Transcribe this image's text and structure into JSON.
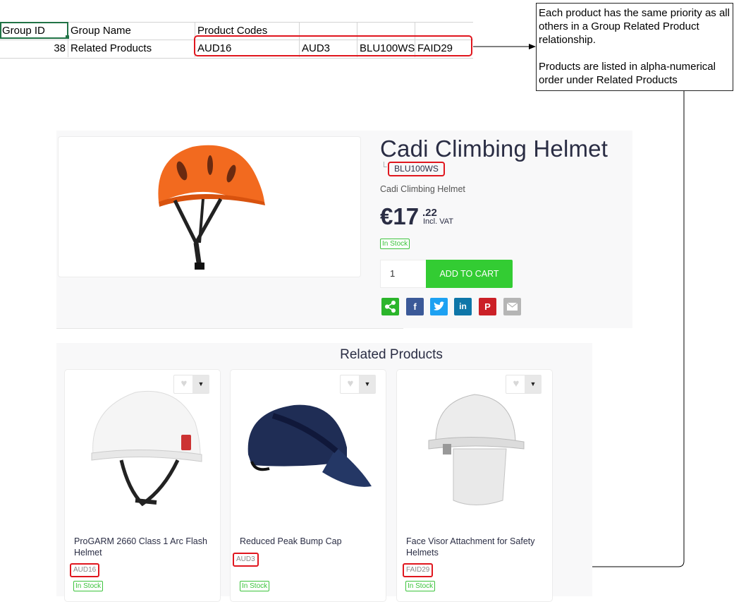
{
  "spreadsheet": {
    "headers": [
      "Group ID",
      "Group Name",
      "Product Codes",
      "",
      "",
      ""
    ],
    "row": [
      "38",
      "Related Products",
      "AUD16",
      "AUD3",
      "BLU100WS",
      "FAID29"
    ]
  },
  "callout": {
    "line1": "Each product has the same priority as all others in a Group Related Product relationship.",
    "line2": "Products are listed in alpha-numerical order under Related Products"
  },
  "product": {
    "title": "Cadi Climbing Helmet",
    "sku_prefix": "└",
    "sku": "BLU100WS",
    "subtitle": "Cadi Climbing Helmet",
    "price_int": "€17",
    "price_dec": ".22",
    "vat": "Incl. VAT",
    "stock": "In Stock",
    "qty": "1",
    "add_to_cart": "ADD TO CART",
    "share_icons": [
      "share-icon",
      "facebook-icon",
      "twitter-icon",
      "linkedin-icon",
      "pinterest-icon",
      "email-icon"
    ],
    "share_colors": [
      "#2bb52b",
      "#3b5998",
      "#1da1f2",
      "#0e76a8",
      "#cb2027",
      "#b5b5b5"
    ]
  },
  "related": {
    "title": "Related Products",
    "items": [
      {
        "name_line1": "ProGARM 2660 Class 1 Arc Flash",
        "name_line2": "Helmet",
        "code": "AUD16",
        "stock": "In Stock"
      },
      {
        "name_line1": "Reduced Peak Bump Cap",
        "name_line2": "",
        "code": "AUD3",
        "stock": "In Stock"
      },
      {
        "name_line1": "Face Visor Attachment for Safety",
        "name_line2": "Helmets",
        "code": "FAID29",
        "stock": "In Stock"
      }
    ]
  },
  "colors": {
    "highlight": "#e0161e",
    "accent_green": "#33cc33",
    "title_text": "#2a2d44"
  }
}
